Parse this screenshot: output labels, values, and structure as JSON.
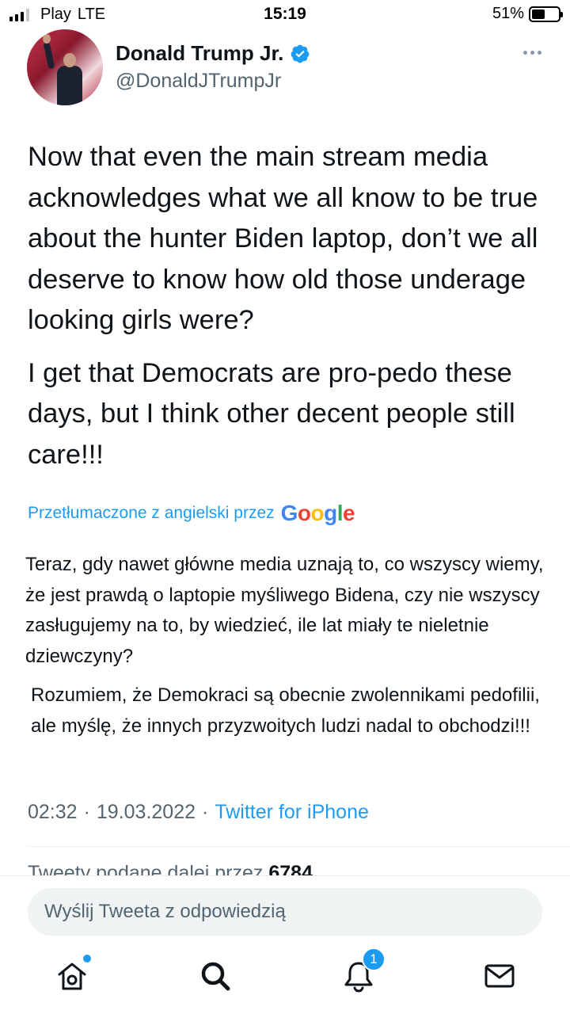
{
  "status_bar": {
    "carrier": "Play",
    "network": "LTE",
    "time": "15:19",
    "battery_percent": "51%",
    "battery_level": 0.51,
    "signal_bars_on": 3,
    "signal_bars_total": 4
  },
  "tweet": {
    "author": {
      "display_name": "Donald Trump Jr.",
      "handle": "@DonaldJTrumpJr",
      "verified": true
    },
    "text_paragraphs": [
      "Now that even the main stream media acknowledges what we all know to be true about the hunter Biden laptop, don’t we all deserve to know how old those underage looking girls were?",
      "I get that Democrats are pro-pedo these days, but I think other decent people still care!!!"
    ],
    "translation": {
      "label": "Przetłumaczone z angielski przez",
      "provider": "Google",
      "paragraphs": [
        "Teraz, gdy nawet główne media uznają to, co wszyscy wiemy, że jest prawdą o laptopie myśliwego Bidena, czy nie wszyscy zasługujemy na to, by wiedzieć, ile lat miały te nieletnie dziewczyny?",
        "Rozumiem, że Demokraci są obecnie zwolennikami pedofilii, ale myślę, że innych przyzwoitych ludzi nadal to obchodzi!!!"
      ]
    },
    "meta": {
      "time": "02:32",
      "separator": "·",
      "date": "19.03.2022",
      "source": "Twitter for iPhone"
    },
    "retweets": {
      "label": "Tweety podane dalej przez",
      "count": "6784"
    }
  },
  "reply": {
    "placeholder": "Wyślij Tweeta z odpowiedzią"
  },
  "tab_bar": {
    "items": [
      {
        "name": "home",
        "icon": "home-icon",
        "has_dot": true
      },
      {
        "name": "search",
        "icon": "search-icon"
      },
      {
        "name": "notifications",
        "icon": "bell-icon",
        "badge": "1"
      },
      {
        "name": "messages",
        "icon": "envelope-icon"
      }
    ]
  },
  "colors": {
    "accent": "#1d9bf0",
    "text": "#0f1419",
    "secondary_text": "#536471"
  }
}
